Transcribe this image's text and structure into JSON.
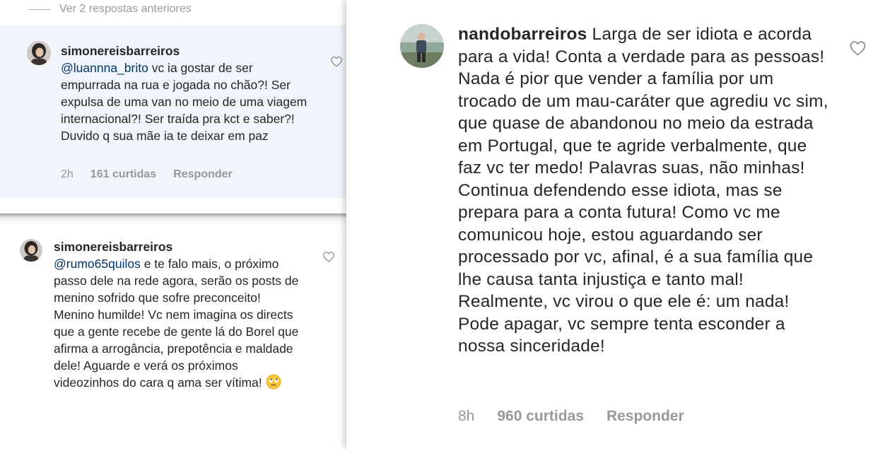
{
  "panel_top_left": {
    "view_previous": "Ver 2 respostas anteriores",
    "comment": {
      "username": "simonereisbarreiros",
      "mention": "@luannna_brito",
      "text": " vc ia gostar de ser empurrada na rua e jogada no chão?! Ser expulsa de uma van no meio de uma viagem internacional?! Ser traída pra kct e saber?! Duvido q sua mãe ia te deixar em paz",
      "time": "2h",
      "likes": "161 curtidas",
      "reply": "Responder"
    }
  },
  "panel_bottom_left": {
    "comment": {
      "username": "simonereisbarreiros",
      "mention": "@rumo65quilos",
      "text": " e te falo mais, o próximo passo dele na rede agora, serão os posts de menino sofrido que sofre preconceito! Menino humilde! Vc nem imagina os directs que a gente recebe de gente lá do Borel que afirma a arrogância, prepotência e maldade dele! Aguarde e verá os próximos videozinhos do cara q ama ser vítima! ",
      "emoji": "face-with-rolling-eyes"
    }
  },
  "panel_right": {
    "comment": {
      "username": "nandobarreiros",
      "text": " Larga de ser idiota e acorda para a vida! Conta a verdade para as pessoas! Nada é pior que vender a família por um trocado de um mau-caráter que agrediu vc sim, que quase de abandonou no meio da estrada em Portugal, que te agride verbalmente, que faz vc ter medo! Palavras suas, não minhas! Continua defendendo esse idiota, mas se prepara para a conta futura! Como vc me comunicou hoje, estou aguardando ser processado por vc, afinal, é a sua família que lhe causa tanta injustiça e tanto mal! Realmente, vc virou o que ele é: um nada! Pode apagar, vc sempre tenta esconder a nossa sinceridade!",
      "time": "8h",
      "likes": "960 curtidas",
      "reply": "Responder"
    }
  },
  "icons": {
    "like": "heart-outline-icon",
    "emoji": "rolling-eyes-emoji-icon"
  },
  "colors": {
    "highlight_bg": "#eff5fb",
    "mention": "#003569",
    "meta_gray": "#999999",
    "text": "#262626"
  }
}
